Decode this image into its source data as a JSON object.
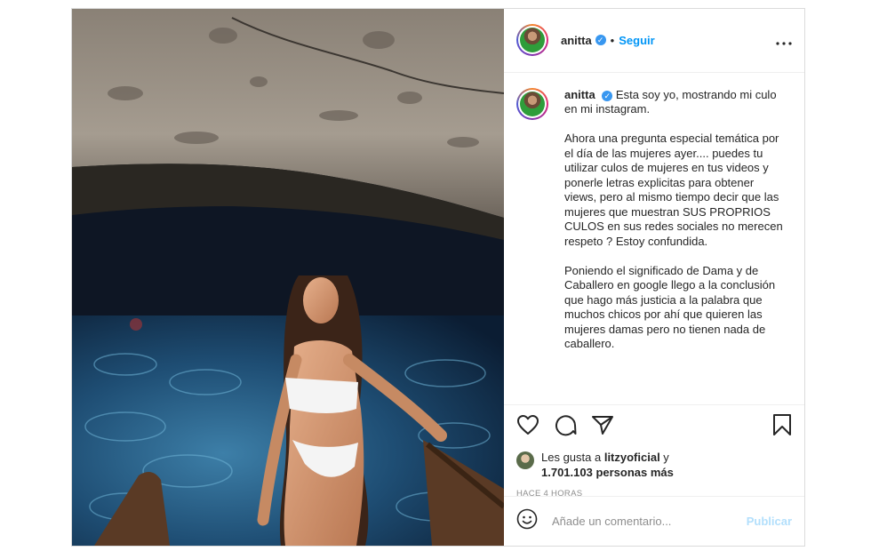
{
  "post": {
    "username": "anitta",
    "verified_icon": "verified-badge-icon",
    "follow_label": "Seguir",
    "separator": "•",
    "more_label": "•••"
  },
  "caption": {
    "username": "anitta",
    "text": "Esta soy yo, mostrando mi culo en mi instagram.\n\nAhora una pregunta especial temática por el día de las mujeres ayer.... puedes tu utilizar culos de mujeres en tus videos y ponerle letras explicitas para obtener views, pero al mismo tiempo decir que las mujeres que muestran SUS PROPRIOS CULOS en sus redes sociales no merecen respeto ? Estoy confundida.\n\nPoniendo el significado de Dama y de Caballero en google llego a la conclusión que hago más justicia a la palabra que muchos chicos por ahí que quieren las mujeres damas pero no tienen nada de caballero."
  },
  "likes": {
    "prefix": "Les gusta a ",
    "user": "litzyoficial",
    "middle": " y",
    "count": "1.701.103 personas más"
  },
  "timestamp": "HACE 4 HORAS",
  "comment_box": {
    "placeholder": "Añade un comentario...",
    "publish_label": "Publicar"
  },
  "colors": {
    "link_blue": "#0095f6",
    "publish_disabled": "#b2dffc",
    "border": "#dbdbdb"
  }
}
